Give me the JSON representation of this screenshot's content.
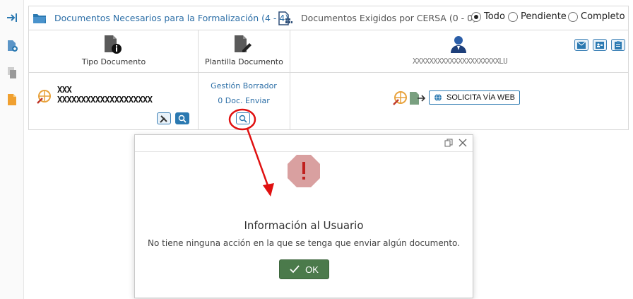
{
  "sidebar": {
    "icons": [
      "expand-arrow-icon",
      "add-document-icon",
      "copy-document-icon",
      "document-icon"
    ]
  },
  "header": {
    "tab_formalizacion": "Documentos Necesarios para la Formalización (4 - 4)",
    "tab_cersa": "Documentos Exigidos por CERSA (0 - 0)",
    "filter_options": [
      "Todo",
      "Pendiente",
      "Completo"
    ],
    "filter_selected": "Todo"
  },
  "columns": {
    "tipo_documento": "Tipo Documento",
    "plantilla_documento": "Plantilla Documento",
    "responsable_name": "XXXXXXXXXXXXXXXXXXXXXLU"
  },
  "row": {
    "doc_title": "XXX",
    "doc_subtitle": "XXXXXXXXXXXXXXXXXXXX",
    "gestion_borrador": "Gestión Borrador",
    "doc_enviar": "0 Doc. Enviar",
    "solicita_web": "SOLICITA VÍA WEB"
  },
  "dialog": {
    "title": "Información al Usuario",
    "message": "No tiene ninguna acción en la que se tenga que enviar algún documento.",
    "ok_label": "OK"
  },
  "colors": {
    "accent": "#2b79b1",
    "ok_green": "#4b7a4b",
    "alert_octagon": "#d9a0a0",
    "annotation_red": "#e01010"
  }
}
